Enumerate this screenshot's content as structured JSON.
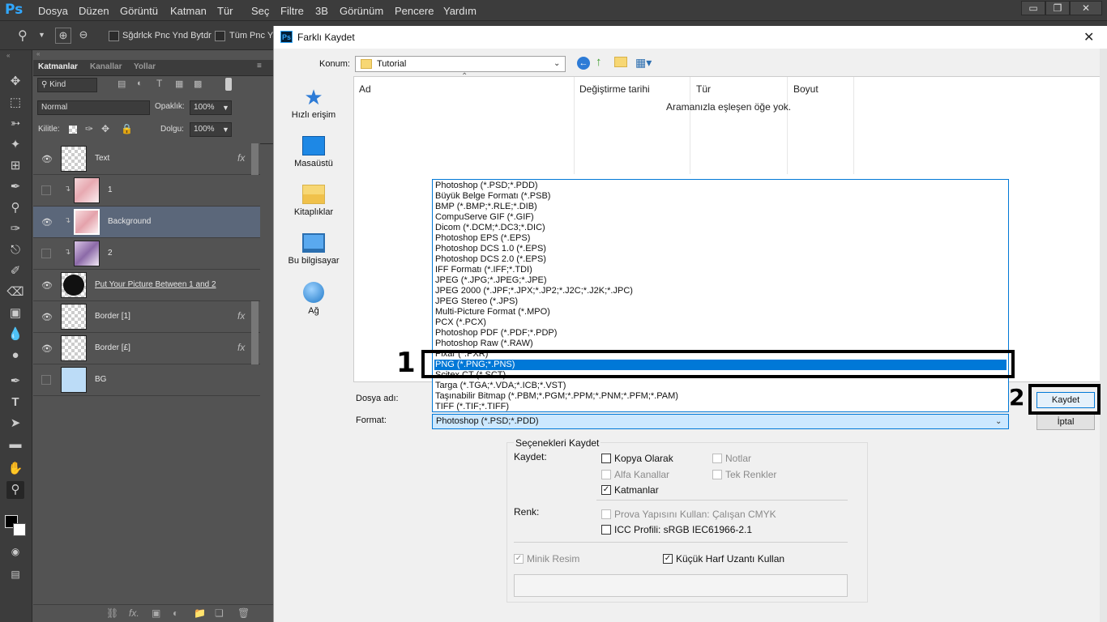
{
  "app": {
    "logo": "Ps",
    "menu": [
      "Dosya",
      "Düzen",
      "Görüntü",
      "Katman",
      "Tür",
      "Seç",
      "Filtre",
      "3B",
      "Görünüm",
      "Pencere",
      "Yardım"
    ],
    "window_buttons": [
      "▭",
      "❐",
      "✕"
    ]
  },
  "options_bar": {
    "option1": "Sğdrlck Pnc Ynd Bytdr",
    "option2": "Tüm Pnc Ya"
  },
  "layers_panel": {
    "tabs": [
      "Katmanlar",
      "Kanallar",
      "Yollar"
    ],
    "kind_label": "Kind",
    "blend_mode": "Normal",
    "opacity_label": "Opaklık:",
    "opacity_value": "100%",
    "lock_label": "Kilitle:",
    "fill_label": "Dolgu:",
    "fill_value": "100%",
    "layers": [
      {
        "name": "Text",
        "visible": true,
        "clip": false,
        "fx": "fx",
        "thumb": "checker"
      },
      {
        "name": "1",
        "visible": false,
        "clip": true,
        "fx": "",
        "thumb": "photo"
      },
      {
        "name": "Background",
        "visible": true,
        "clip": true,
        "fx": "",
        "thumb": "photo",
        "selected": true
      },
      {
        "name": "2",
        "visible": false,
        "clip": true,
        "fx": "",
        "thumb": "photo2"
      },
      {
        "name": "Put Your Picture Between 1 and 2",
        "visible": true,
        "clip": false,
        "fx": "",
        "thumb": "circle"
      },
      {
        "name": "Border [1]",
        "visible": true,
        "clip": false,
        "fx": "fx",
        "thumb": "checker"
      },
      {
        "name": "Border [£]",
        "visible": true,
        "clip": false,
        "fx": "fx",
        "thumb": "checker"
      },
      {
        "name": "BG",
        "visible": false,
        "clip": false,
        "fx": "",
        "thumb": "blue"
      }
    ]
  },
  "dialog": {
    "icon": "Ps",
    "title": "Farklı Kaydet",
    "close": "✕",
    "location_label": "Konum:",
    "location_value": "Tutorial",
    "places": [
      "Hızlı erişim",
      "Masaüstü",
      "Kitaplıklar",
      "Bu bilgisayar",
      "Ağ"
    ],
    "columns": [
      "Ad",
      "Değiştirme tarihi",
      "Tür",
      "Boyut"
    ],
    "empty_message": "Aramanızla eşleşen öğe yok.",
    "filename_label": "Dosya adı:",
    "format_label": "Format:",
    "format_value": "Photoshop (*.PSD;*.PDD)",
    "format_options": [
      "Photoshop (*.PSD;*.PDD)",
      "Büyük Belge Formatı (*.PSB)",
      "BMP (*.BMP;*.RLE;*.DIB)",
      "CompuServe GIF (*.GIF)",
      "Dicom (*.DCM;*.DC3;*.DIC)",
      "Photoshop EPS (*.EPS)",
      "Photoshop DCS 1.0 (*.EPS)",
      "Photoshop DCS 2.0 (*.EPS)",
      "IFF Formatı (*.IFF;*.TDI)",
      "JPEG (*.JPG;*.JPEG;*.JPE)",
      "JPEG 2000 (*.JPF;*.JPX;*.JP2;*.J2C;*.J2K;*.JPC)",
      "JPEG Stereo (*.JPS)",
      "Multi-Picture Format (*.MPO)",
      "PCX (*.PCX)",
      "Photoshop PDF (*.PDF;*.PDP)",
      "Photoshop Raw (*.RAW)",
      "Pixar (*.PXR)",
      "PNG (*.PNG;*.PNS)",
      "Scitex CT (*.SCT)",
      "Targa (*.TGA;*.VDA;*.ICB;*.VST)",
      "Taşınabilir Bitmap (*.PBM;*.PGM;*.PPM;*.PNM;*.PFM;*.PAM)",
      "TIFF (*.TIF;*.TIFF)"
    ],
    "selected_format_index": 17,
    "save_button": "Kaydet",
    "cancel_button": "İptal",
    "save_options": {
      "group_title": "Seçenekleri Kaydet",
      "save_label": "Kaydet:",
      "as_copy": "Kopya Olarak",
      "notes": "Notlar",
      "alpha_channels": "Alfa Kanallar",
      "spot_colors": "Tek Renkler",
      "layers": "Katmanlar",
      "color_label": "Renk:",
      "proof_setup": "Prova Yapısını Kullan: Çalışan CMYK",
      "icc_profile": "ICC Profili: sRGB IEC61966-2.1",
      "thumbnail": "Minik Resim",
      "lowercase_ext": "Küçük Harf Uzantı Kullan",
      "check_mark": "✓"
    }
  },
  "annotations": {
    "step1": "1",
    "step2": "2"
  }
}
